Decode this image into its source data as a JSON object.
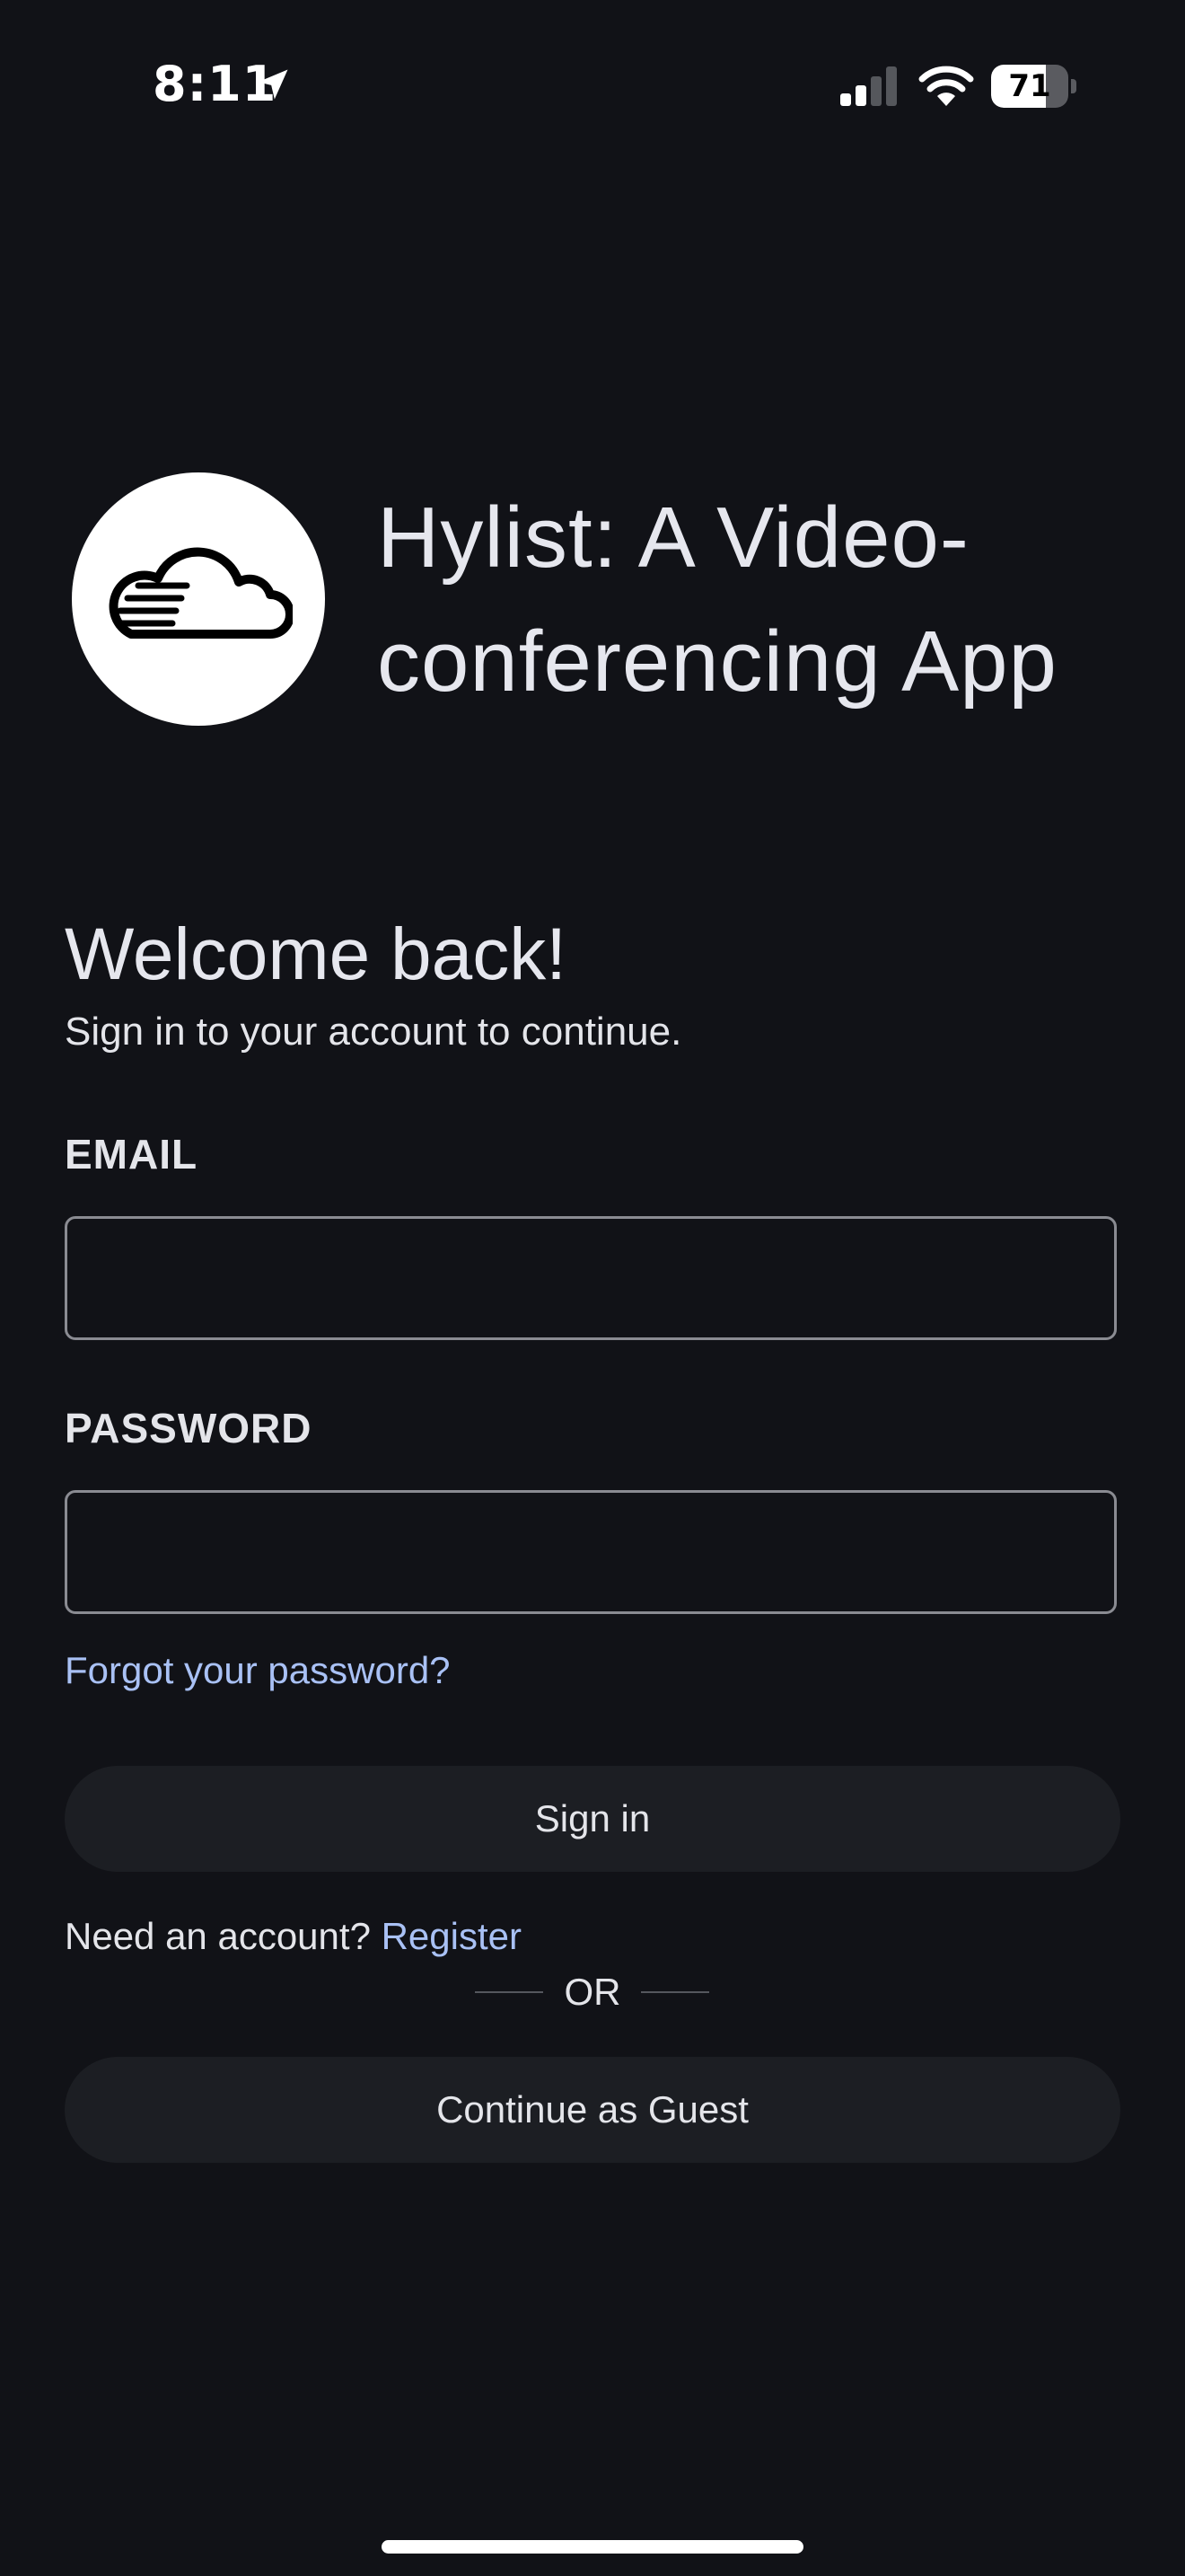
{
  "status_bar": {
    "time": "8:11",
    "battery_level": "71",
    "battery_fraction": 0.71,
    "icons": [
      "location-arrow-icon",
      "cellular-signal-icon",
      "wifi-icon",
      "battery-icon"
    ]
  },
  "header": {
    "logo_icon": "cloud-icon",
    "app_title": "Hylist: A Video-conferencing App"
  },
  "welcome": {
    "title": "Welcome back!",
    "subtitle": "Sign in to your account to continue."
  },
  "form": {
    "email_label": "EMAIL",
    "email_value": "",
    "password_label": "PASSWORD",
    "password_value": "",
    "forgot_password": "Forgot your password?",
    "sign_in": "Sign in",
    "need_account": "Need an account?",
    "register": "Register",
    "or": "OR",
    "guest": "Continue as Guest"
  },
  "colors": {
    "background": "#111217",
    "button": "#1c1e23",
    "link": "#a9c1f5",
    "text": "#e4e5ea",
    "input_border": "#8a8b92"
  }
}
